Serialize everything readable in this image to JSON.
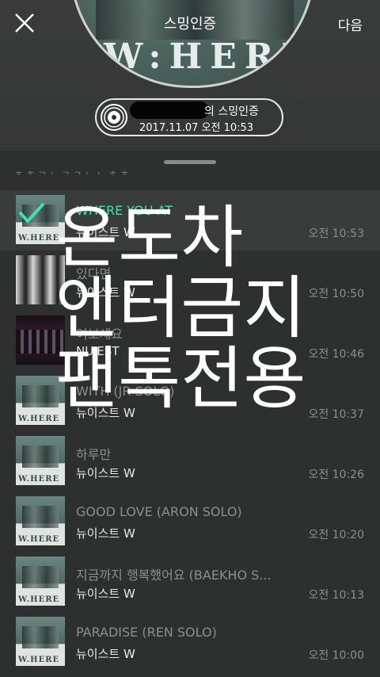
{
  "header": {
    "title": "스밍인증",
    "next_label": "다음",
    "album_art_text": "W:HERE"
  },
  "badge": {
    "line1": "의 스밍인증",
    "line2": "2017.11.07 오전 10:53"
  },
  "sheet": {
    "hint": "ㅎ ㅎ ㄱ ㄴ ㄱ ㄱ ㄴ ㄴ ㅎ ㅎ"
  },
  "songs": [
    {
      "title": "WHERE YOU AT",
      "artist": "뉴이스트 W",
      "time": "오전 10:53",
      "selected": true
    },
    {
      "title": "있다면",
      "artist": "뉴이스트 W",
      "time": "오전 10:50",
      "selected": false
    },
    {
      "title": "여보세요",
      "artist": "NU'EST",
      "time": "오전 10:46",
      "selected": false
    },
    {
      "title": "WITH (JR SOLO)",
      "artist": "뉴이스트 W",
      "time": "오전 10:37",
      "selected": false
    },
    {
      "title": "하루만",
      "artist": "뉴이스트 W",
      "time": "오전 10:26",
      "selected": false
    },
    {
      "title": "GOOD LOVE (ARON SOLO)",
      "artist": "뉴이스트 W",
      "time": "오전 10:20",
      "selected": false
    },
    {
      "title": "지금까지 행복했어요 (BAEKHO S...",
      "artist": "뉴이스트 W",
      "time": "오전 10:13",
      "selected": false
    },
    {
      "title": "PARADISE (REN SOLO)",
      "artist": "뉴이스트 W",
      "time": "오전 10:00",
      "selected": false
    }
  ],
  "overlay_text": [
    "온도차",
    "엔터금지",
    "팬톡전용"
  ],
  "colors": {
    "accent": "#3ee0b6",
    "background": "#2e2f2f"
  }
}
